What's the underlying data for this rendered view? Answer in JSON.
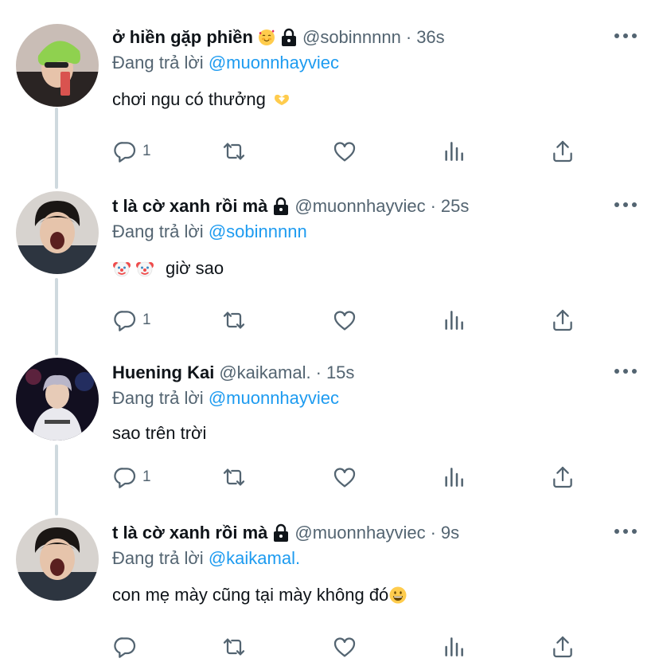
{
  "tweets": [
    {
      "name": "ở hiền gặp phiền",
      "handle": "@sobinnnnn",
      "separator": "·",
      "time": "36s",
      "reply_label": "Đang trả lời",
      "reply_to": "@muonnhayviec",
      "text": "chơi ngu có thưởng",
      "reply_count": "1"
    },
    {
      "name": "t là cờ xanh rồi mà",
      "handle": "@muonnhayviec",
      "separator": "·",
      "time": "25s",
      "reply_label": "Đang trả lời",
      "reply_to": "@sobinnnnn",
      "text": "giờ sao",
      "reply_count": "1"
    },
    {
      "name": "Huening Kai",
      "handle": "@kaikamal.",
      "separator": "·",
      "time": "15s",
      "reply_label": "Đang trả lời",
      "reply_to": "@muonnhayviec",
      "text": "sao trên trời",
      "reply_count": "1"
    },
    {
      "name": "t là cờ xanh rồi mà",
      "handle": "@muonnhayviec",
      "separator": "·",
      "time": "9s",
      "reply_label": "Đang trả lời",
      "reply_to": "@kaikamal.",
      "text": "con mẹ mày cũng tại mày không đó",
      "reply_count": ""
    }
  ],
  "colors": {
    "text": "#0f1419",
    "secondary": "#536471",
    "link": "#1d9bf0",
    "thread_line": "#cfd9de"
  },
  "icons": [
    "reply-icon",
    "retweet-icon",
    "like-icon",
    "analytics-icon",
    "share-icon",
    "more-icon",
    "lock-icon"
  ]
}
